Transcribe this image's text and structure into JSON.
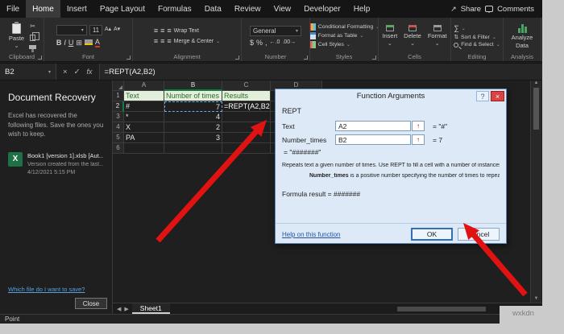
{
  "menu": {
    "tabs": [
      "File",
      "Home",
      "Insert",
      "Page Layout",
      "Formulas",
      "Data",
      "Review",
      "View",
      "Developer",
      "Help"
    ],
    "share": "Share",
    "comments": "Comments"
  },
  "ribbon": {
    "group_labels": [
      "Clipboard",
      "Font",
      "Alignment",
      "Number",
      "Styles",
      "Cells",
      "Editing",
      "Analysis"
    ],
    "paste": "Paste",
    "font_size": "11",
    "wrap_text": "Wrap Text",
    "merge_center": "Merge & Center",
    "number_format": "General",
    "styles_buttons": [
      "Conditional Formatting",
      "Format as Table",
      "Cell Styles"
    ],
    "cells_buttons": [
      "Insert",
      "Delete",
      "Format"
    ],
    "sort_filter": "Sort & Filter",
    "find_select": "Find & Select",
    "analyze_line1": "Analyze",
    "analyze_line2": "Data"
  },
  "formula_bar": {
    "name_box": "B2",
    "formula": "=REPT(A2,B2)"
  },
  "recovery": {
    "title": "Document Recovery",
    "intro": "Excel has recovered the following files. Save the ones you wish to keep.",
    "file_name": "Book1 [version 1].xlsb [Aut...",
    "file_detail": "Version created from the last...",
    "file_time": "4/12/2021 5:15 PM",
    "question": "Which file do I want to save?",
    "close": "Close"
  },
  "sheet": {
    "columns": [
      "A",
      "B",
      "C",
      "D"
    ],
    "rows": [
      {
        "n": "1",
        "a": "Text",
        "b": "Number of times",
        "c": "Results",
        "d": ""
      },
      {
        "n": "2",
        "a": "#",
        "b": "7",
        "c": "=REPT(A2,B2)",
        "d": ""
      },
      {
        "n": "3",
        "a": "*",
        "b": "4",
        "c": "",
        "d": ""
      },
      {
        "n": "4",
        "a": "X",
        "b": "2",
        "c": "",
        "d": ""
      },
      {
        "n": "5",
        "a": "PA",
        "b": "3",
        "c": "",
        "d": ""
      },
      {
        "n": "6",
        "a": "",
        "b": "",
        "c": "",
        "d": ""
      }
    ],
    "tab": "Sheet1",
    "status": "Point"
  },
  "dialog": {
    "title": "Function Arguments",
    "fn": "REPT",
    "rows": [
      {
        "label": "Text",
        "value": "A2",
        "result": "=  \"#\""
      },
      {
        "label": "Number_times",
        "value": "B2",
        "result": "=  7"
      }
    ],
    "interim": "=  \"#######\"",
    "desc": "Repeats text a given number of times. Use REPT to fill a cell with a number of instances of a text string.",
    "arg_bold": "Number_times",
    "arg_rest": " is a positive number specifying the number of times to repeat text.",
    "formula_result": "Formula result =  #######",
    "help": "Help on this function",
    "ok": "OK",
    "cancel": "Cancel"
  },
  "icons": {
    "chevron": "⌄",
    "dropdown": "▾",
    "cut": "✂",
    "bold": "B",
    "italic": "I",
    "underline": "U",
    "grow_font": "A▴",
    "shrink_font": "A▾",
    "borders": "⊞",
    "font_color": "A",
    "align": "≡",
    "dollar": "$",
    "percent": "%",
    "comma": ",",
    "decimal_increase": "←.0",
    "decimal_decrease": ".00→",
    "sigma": "∑",
    "sort": "⇅",
    "share": "↗",
    "cancel": "×",
    "enter": "✓",
    "fx": "fx",
    "scroll_up": "▲",
    "scroll_down": "▼",
    "tab_left": "◀",
    "tab_right": "▶",
    "range_picker": "↑",
    "help": "?",
    "close": "×",
    "file_x": "X"
  },
  "watermark": "wxkdn",
  "colors": {
    "arrow": "#e01212",
    "row1_bg": "#e2efda",
    "row1_text": "#2f6b2f",
    "dialog_bg": "#dde9f7",
    "dialog_border": "#5b87b7",
    "close_button_red": "#d64444",
    "excel_green": "#1e7145"
  }
}
